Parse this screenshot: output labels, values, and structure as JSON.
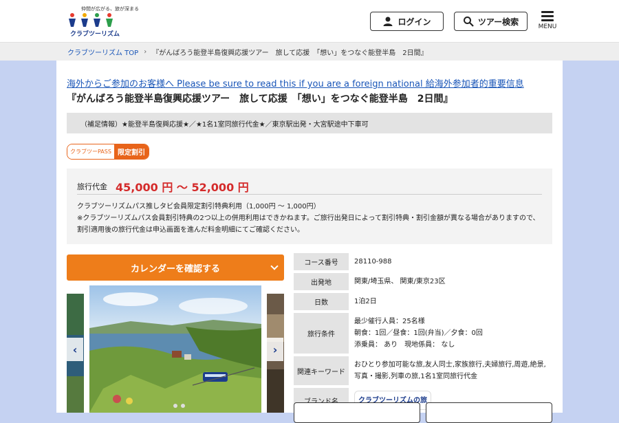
{
  "header": {
    "logo_tagline": "仲間が広がる、旅が深まる",
    "logo_name": "クラブツーリズム",
    "login_label": "ログイン",
    "search_label": "ツアー検索",
    "menu_label": "MENU"
  },
  "breadcrumb": {
    "home": "クラブツーリズム TOP",
    "current": "『がんばろう能登半島復興応援ツアー　旅して応援　「想い」をつなぐ能登半島　2日間』"
  },
  "foreign_link": "海外からご参加のお客様へ Please be sure to read this if you are a foreign national 給海外参加者的重要信息",
  "tour_title": "『がんばろう能登半島復興応援ツアー　旅して応援　「想い」をつなぐ能登半島　2日間』",
  "supplement": "（補足情報）★能登半島復興応援★／★1名1室同旅行代金★／東京駅出発・大宮駅途中下車可",
  "pass_badge": {
    "left": "クラブツーPASS",
    "right": "限定割引"
  },
  "price": {
    "label": "旅行代金",
    "value": "45,000 円 〜 52,000 円",
    "note_line1": "クラブツーリズムパス推しタビ会員限定割引特典利用（1,000円 〜 1,000円）",
    "note_line2": "※クラブツーリズムパス会員割引特典の2つ以上の併用利用はできかねます。ご旅行出発日によって割引特典・割引金額が異なる場合がありますので、割引適用後の旅行代金は申込画面を進んだ料金明細にてご確認ください。"
  },
  "calendar_button": "カレンダーを確認する",
  "info": {
    "course_key": "コース番号",
    "course_val": "28110-988",
    "departure_key": "出発地",
    "departure_val": "関東/埼玉県、 関東/東京23区",
    "days_key": "日数",
    "days_val": "1泊2日",
    "conditions_key": "旅行条件",
    "cond_line1": "最少催行人員：25名様",
    "cond_line2": "朝食：1回／昼食：1回(弁当)／夕食：0回",
    "cond_line3": "添乗員： あり　現地係員： なし",
    "keywords_key": "関連キーワード",
    "keywords_val": "おひとり参加可能な旅,友人同士,家族旅行,夫婦旅行,周遊,絶景,写真・撮影,列車の旅,1名1室同旅行代金",
    "brand_key": "ブランド名",
    "brand_val": "クラブツーリズムの旅"
  },
  "colors": {
    "accent_orange": "#ee7d1a",
    "price_red": "#d42b2b",
    "link_blue": "#1a56b8",
    "bg_blue": "#c5d2f2"
  }
}
